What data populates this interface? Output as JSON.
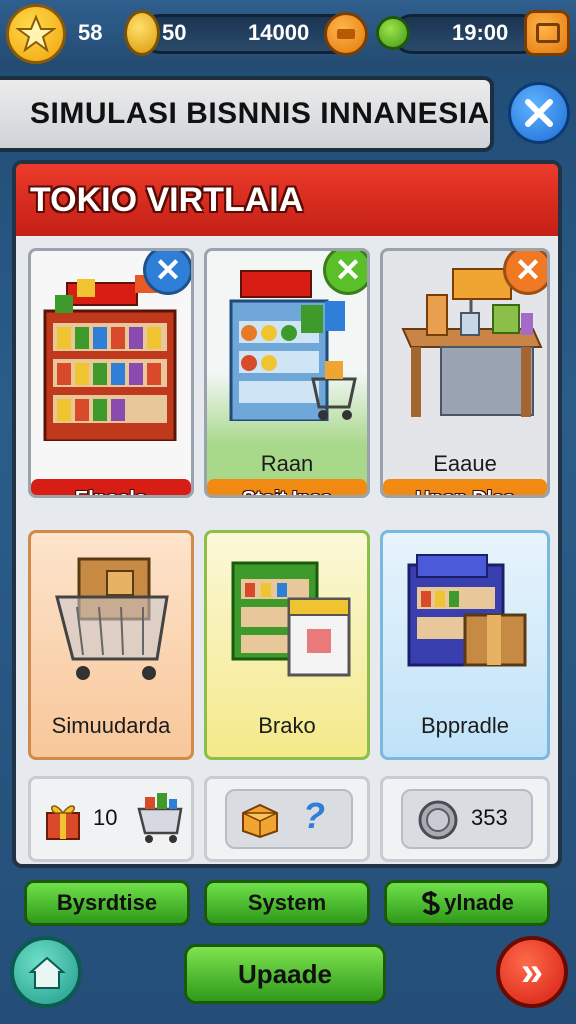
{
  "topbar": {
    "stars": "58",
    "coins": "50",
    "money": "14000",
    "time": "19:00"
  },
  "title": "SIMULASI BISNNIS INNANESIA",
  "panel": {
    "header": "TOKIO VIRTLAIA",
    "cards": [
      {
        "label": "",
        "button": "Elpoalo",
        "button_color": "#d81e14"
      },
      {
        "label": "Raan",
        "button": "Stoit Inea",
        "button_color": "#f08a12"
      },
      {
        "label": "Eaaue",
        "button": "Hpon Dles",
        "button_color": "#f08a12"
      },
      {
        "label": "Simuudarda",
        "button": ""
      },
      {
        "label": "Brako",
        "button": ""
      },
      {
        "label": "Bppradle",
        "button": ""
      }
    ],
    "stats": {
      "gifts": "10",
      "help_symbol": "?",
      "coins": "353"
    }
  },
  "bottom": {
    "btn1": "Bysrdtise",
    "btn2": "System",
    "btn3": "ylnade",
    "main": "Upaade",
    "next_symbol": "»"
  },
  "colors": {
    "accent_red": "#d81e14",
    "accent_orange": "#f08a12",
    "accent_green": "#3ea81f",
    "accent_blue": "#1c6dd4"
  }
}
